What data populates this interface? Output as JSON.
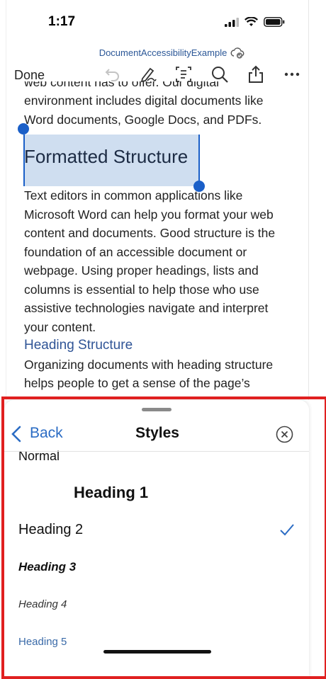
{
  "status_bar": {
    "time": "1:17"
  },
  "header": {
    "doc_title": "DocumentAccessibilityExample",
    "done_label": "Done"
  },
  "document": {
    "intro_lines": [
      "web content has to offer. Our digital",
      "environment includes digital documents like",
      "Word documents, Google Docs, and PDFs."
    ],
    "selected_heading": "Formatted Structure",
    "body_lines": [
      "Text editors in common applications like",
      "Microsoft Word can help you format your web",
      "content and documents. Good structure is the",
      "foundation of an accessible document or",
      "webpage. Using proper headings, lists and",
      "columns is essential to help those who use",
      "assistive technologies navigate and interpret",
      "your content."
    ],
    "subheading": "Heading Structure",
    "tail_lines": [
      "Organizing documents with heading structure",
      "helps people to get a sense of the page’s"
    ]
  },
  "styles_sheet": {
    "back_label": "Back",
    "title": "Styles",
    "items": [
      {
        "label": "Normal"
      },
      {
        "label": "Heading 1"
      },
      {
        "label": "Heading 2",
        "selected": true
      },
      {
        "label": "Heading 3"
      },
      {
        "label": "Heading 4"
      },
      {
        "label": "Heading 5"
      }
    ]
  },
  "colors": {
    "accent": "#2b6cc4",
    "selection": "#cfdef0",
    "highlight_frame": "#e02020"
  }
}
